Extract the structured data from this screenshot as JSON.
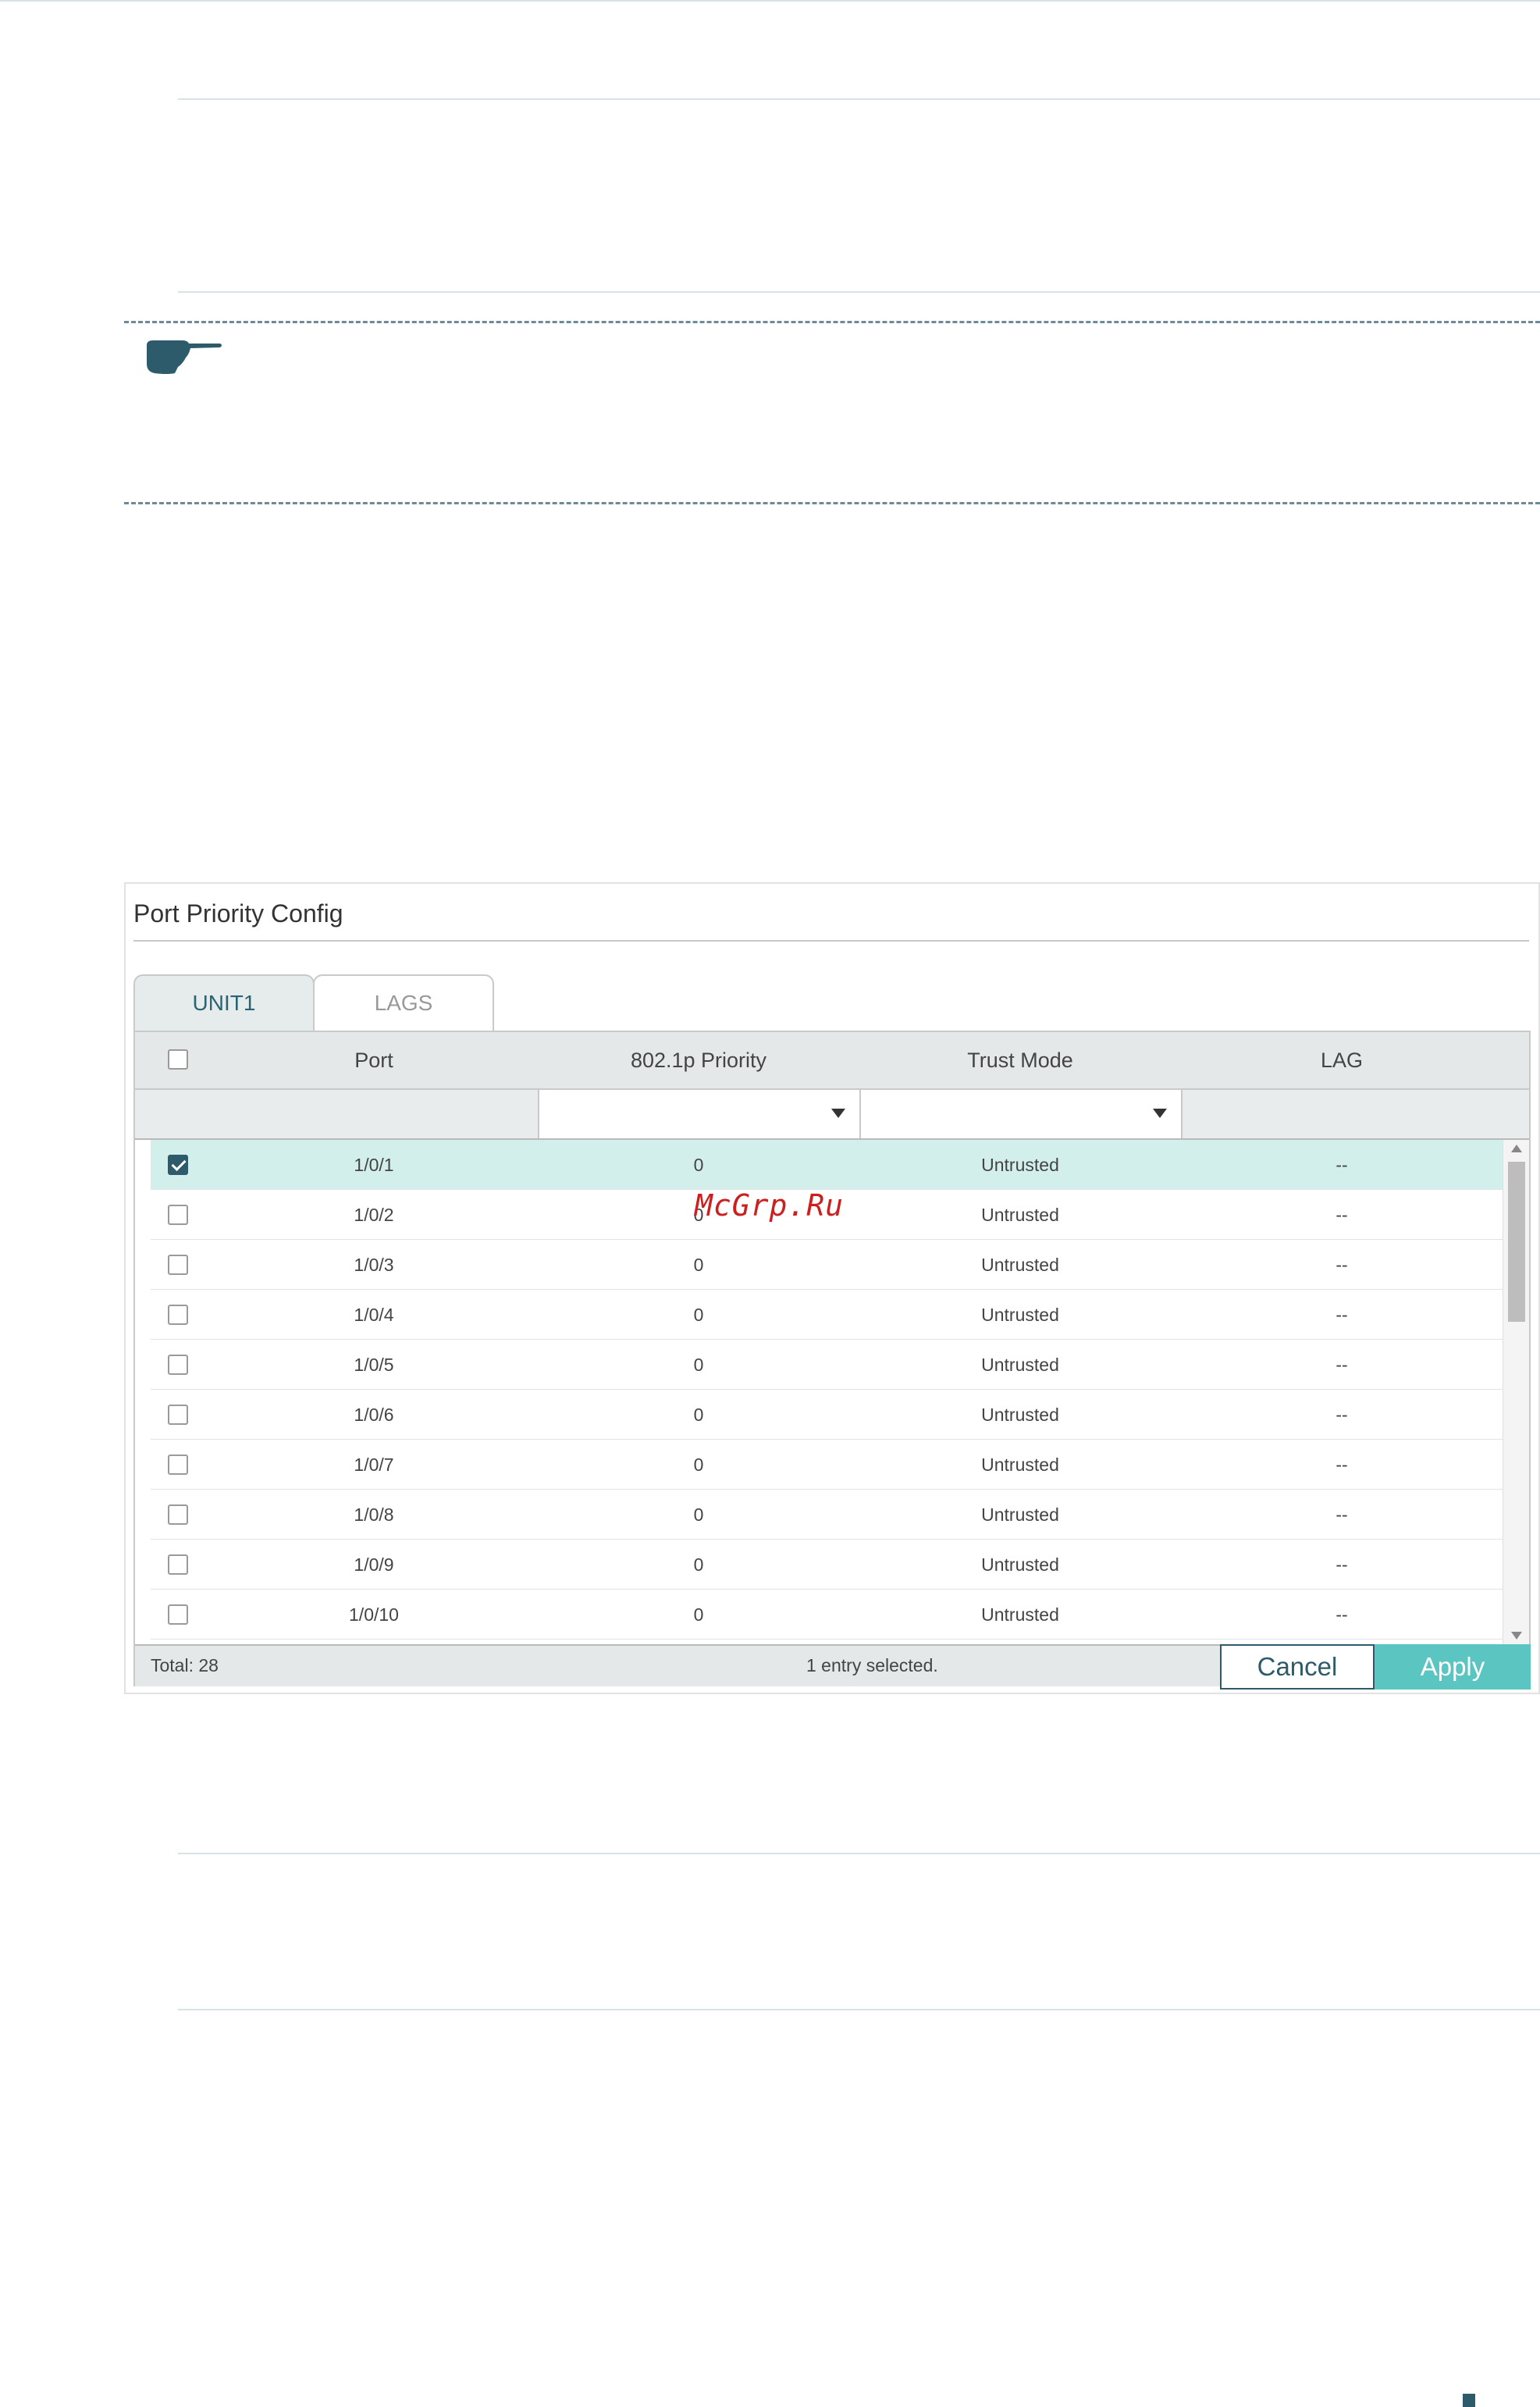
{
  "panel": {
    "title": "Port Priority Config",
    "tabs": [
      {
        "label": "UNIT1",
        "active": true
      },
      {
        "label": "LAGS",
        "active": false
      }
    ],
    "columns": {
      "port": "Port",
      "priority": "802.1p Priority",
      "trust_mode": "Trust Mode",
      "lag": "LAG"
    },
    "rows": [
      {
        "port": "1/0/1",
        "priority": "0",
        "trust_mode": "Untrusted",
        "lag": "--",
        "checked": true
      },
      {
        "port": "1/0/2",
        "priority": "0",
        "trust_mode": "Untrusted",
        "lag": "--",
        "checked": false
      },
      {
        "port": "1/0/3",
        "priority": "0",
        "trust_mode": "Untrusted",
        "lag": "--",
        "checked": false
      },
      {
        "port": "1/0/4",
        "priority": "0",
        "trust_mode": "Untrusted",
        "lag": "--",
        "checked": false
      },
      {
        "port": "1/0/5",
        "priority": "0",
        "trust_mode": "Untrusted",
        "lag": "--",
        "checked": false
      },
      {
        "port": "1/0/6",
        "priority": "0",
        "trust_mode": "Untrusted",
        "lag": "--",
        "checked": false
      },
      {
        "port": "1/0/7",
        "priority": "0",
        "trust_mode": "Untrusted",
        "lag": "--",
        "checked": false
      },
      {
        "port": "1/0/8",
        "priority": "0",
        "trust_mode": "Untrusted",
        "lag": "--",
        "checked": false
      },
      {
        "port": "1/0/9",
        "priority": "0",
        "trust_mode": "Untrusted",
        "lag": "--",
        "checked": false
      },
      {
        "port": "1/0/10",
        "priority": "0",
        "trust_mode": "Untrusted",
        "lag": "--",
        "checked": false
      }
    ],
    "footer": {
      "total": "Total: 28",
      "selected": "1 entry selected.",
      "cancel_label": "Cancel",
      "apply_label": "Apply"
    }
  },
  "watermark": "McGrp.Ru",
  "colors": {
    "accent_dark": "#2d5b6b",
    "accent_light": "#5bc6c1",
    "selected_row": "#d3efec",
    "watermark": "#cc2020"
  },
  "icons": {
    "note": "pointing-hand-icon",
    "dropdown": "caret-down-icon"
  }
}
